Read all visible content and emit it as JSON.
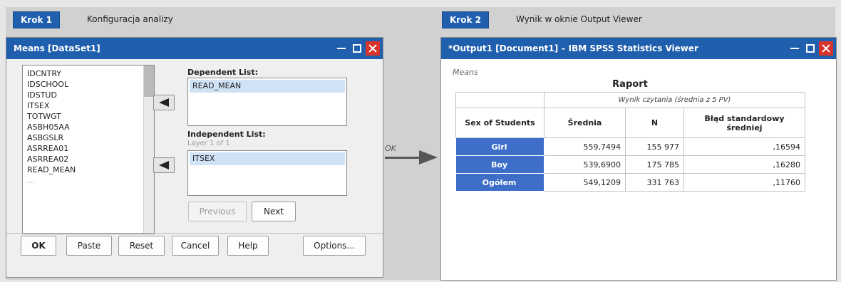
{
  "step1": {
    "badge": "Krok 1",
    "description": "Konfiguracja analizy"
  },
  "step2": {
    "badge": "Krok 2",
    "description": "Wynik w oknie Output Viewer"
  },
  "dialog": {
    "title": "Means [DataSet1]",
    "variables": [
      "IDCNTRY",
      "IDSCHOOL",
      "IDSTUD",
      "ITSEX",
      "TOTWGT",
      "ASBH05AA",
      "ASBGSLR",
      "ASRREA01",
      "ASRREA02",
      "READ_MEAN",
      "..."
    ],
    "dependent_label": "Dependent List:",
    "dependent_items": [
      "READ_MEAN"
    ],
    "independent_label": "Independent List:",
    "layer_label": "Layer 1 of 1",
    "independent_items": [
      "ITSEX"
    ],
    "previous_label": "Previous",
    "next_label": "Next",
    "buttons": {
      "ok": "OK",
      "paste": "Paste",
      "reset": "Reset",
      "cancel": "Cancel",
      "help": "Help",
      "options": "Options..."
    }
  },
  "connector": {
    "label": "OK"
  },
  "viewer": {
    "title": "*Output1 [Document1] – IBM SPSS Statistics Viewer",
    "caption": "Means",
    "report_title": "Raport",
    "group_header": "Wynik czytania (średnia z 5 PV)",
    "columns": [
      "Sex of Students",
      "Średnia",
      "N",
      "Błąd standardowy średniej"
    ],
    "rows": [
      {
        "label": "Girl",
        "mean": "559,7494",
        "n": "155 977",
        "se": ",16594"
      },
      {
        "label": "Boy",
        "mean": "539,6900",
        "n": "175 785",
        "se": ",16280"
      },
      {
        "label": "Ogółem",
        "mean": "549,1209",
        "n": "331 763",
        "se": ",11760"
      }
    ]
  },
  "colors": {
    "titlebar": "#1f5fae",
    "row_header": "#3f6ec9",
    "close": "#d9342b",
    "selection": "#cfe2f6"
  }
}
